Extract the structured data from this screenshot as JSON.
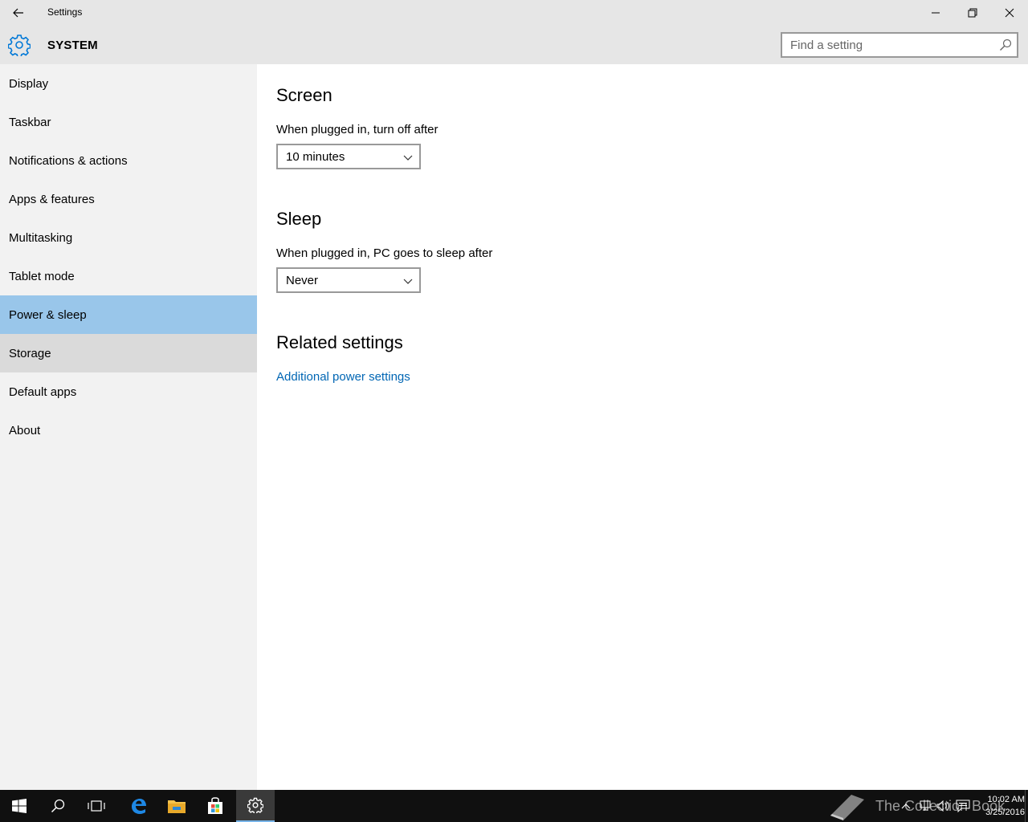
{
  "window": {
    "title": "Settings",
    "back_icon": "back-arrow-icon",
    "minimize_icon": "minimize-icon",
    "maximize_icon": "restore-icon",
    "close_icon": "close-icon"
  },
  "header": {
    "section": "SYSTEM",
    "logo_icon": "gear-icon",
    "search": {
      "placeholder": "Find a setting",
      "value": "",
      "icon": "search-icon"
    }
  },
  "sidebar": {
    "items": [
      {
        "label": "Display"
      },
      {
        "label": "Taskbar"
      },
      {
        "label": "Notifications & actions"
      },
      {
        "label": "Apps & features"
      },
      {
        "label": "Multitasking"
      },
      {
        "label": "Tablet mode"
      },
      {
        "label": "Power & sleep",
        "selected": true
      },
      {
        "label": "Storage",
        "hover": true
      },
      {
        "label": "Default apps"
      },
      {
        "label": "About"
      }
    ]
  },
  "main": {
    "screen": {
      "heading": "Screen",
      "label": "When plugged in, turn off after",
      "value": "10 minutes"
    },
    "sleep": {
      "heading": "Sleep",
      "label": "When plugged in, PC goes to sleep after",
      "value": "Never"
    },
    "related": {
      "heading": "Related settings",
      "link": "Additional power settings"
    }
  },
  "taskbar": {
    "items": [
      "start-icon",
      "search-icon",
      "task-view-icon",
      "edge-icon",
      "file-explorer-icon",
      "store-icon",
      "settings-icon"
    ],
    "watermark": "The Collection Book",
    "clock": {
      "time": "10:02 AM",
      "date": "3/25/2016"
    }
  },
  "colors": {
    "accent": "#0066b4",
    "selected_bg": "#99c6ea",
    "sidebar_bg": "#f2f2f2",
    "header_bg": "#e6e6e6",
    "taskbar_bg": "#101010"
  }
}
